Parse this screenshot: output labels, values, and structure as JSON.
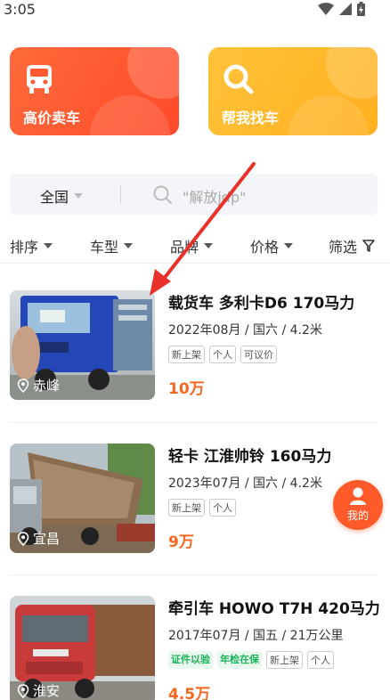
{
  "status_bar": {
    "time": "3:05"
  },
  "promos": [
    {
      "label": "高价卖车",
      "icon": "truck-icon",
      "color": "#ff5230"
    },
    {
      "label": "帮我找车",
      "icon": "search-icon",
      "color": "#ffb428"
    }
  ],
  "search": {
    "region": "全国",
    "placeholder": "\"解放jdp\""
  },
  "filters": [
    {
      "label": "排序"
    },
    {
      "label": "车型"
    },
    {
      "label": "品牌"
    },
    {
      "label": "价格"
    },
    {
      "label": "筛选"
    }
  ],
  "listings": [
    {
      "title": "载货车 多利卡D6 170马力",
      "spec": "2022年08月 / 国六 / 4.2米",
      "tags": [
        "新上架",
        "个人",
        "可议价"
      ],
      "green_tags": [],
      "price": "10万",
      "location": "赤峰"
    },
    {
      "title": "轻卡 江淮帅铃 160马力",
      "spec": "2023年07月 / 国六 / 4.2米",
      "tags": [
        "新上架",
        "个人"
      ],
      "green_tags": [],
      "price": "9万",
      "location": "宜昌"
    },
    {
      "title": "牵引车 HOWO T7H 420马力",
      "spec": "2017年07月 / 国五 / 21万公里",
      "tags": [
        "新上架",
        "个人"
      ],
      "green_tags": [
        "证件以验",
        "年检在保"
      ],
      "price": "4.5万",
      "location": "淮安"
    }
  ],
  "fab": {
    "label": "我的"
  },
  "colors": {
    "accent": "#f5661e",
    "sell": "#ff5230",
    "find": "#ffb428",
    "green_tag": "#1ab45a"
  }
}
